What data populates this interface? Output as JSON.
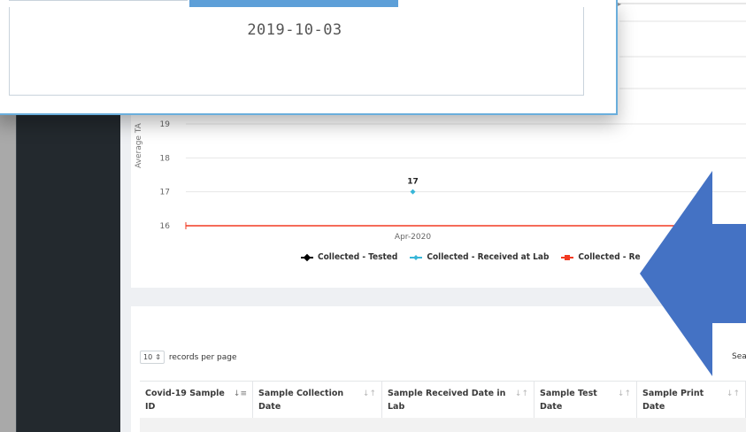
{
  "popup": {
    "date_value": "2019-10-03"
  },
  "chart_data": {
    "type": "line",
    "ylabel": "Average TA",
    "y_ticks": [
      "16",
      "17",
      "18",
      "19"
    ],
    "x_categories": [
      "Apr-2020"
    ],
    "series": [
      {
        "name": "Collected - Tested",
        "color": "#000000",
        "values": []
      },
      {
        "name": "Collected - Received at Lab",
        "color": "#38b6d8",
        "values": [
          17
        ],
        "data_labels": [
          "17"
        ]
      },
      {
        "name": "Collected - Re",
        "color": "#f23a22",
        "values": [
          16
        ]
      }
    ],
    "ylim": [
      16,
      19
    ]
  },
  "table": {
    "records_select": "10",
    "records_label": "records per page",
    "search_label": "Sea",
    "columns": [
      {
        "label": "Covid-19 Sample ID",
        "sort": "asc"
      },
      {
        "label": "Sample Collection Date",
        "sort": "none"
      },
      {
        "label": "Sample Received Date in Lab",
        "sort": "none"
      },
      {
        "label": "Sample Test Date",
        "sort": "none"
      },
      {
        "label": "Sample Print Date",
        "sort": "none"
      }
    ]
  },
  "colors": {
    "sidebar": "#23292e",
    "accent": "#5d9fd8",
    "arrow": "#4472c4"
  }
}
